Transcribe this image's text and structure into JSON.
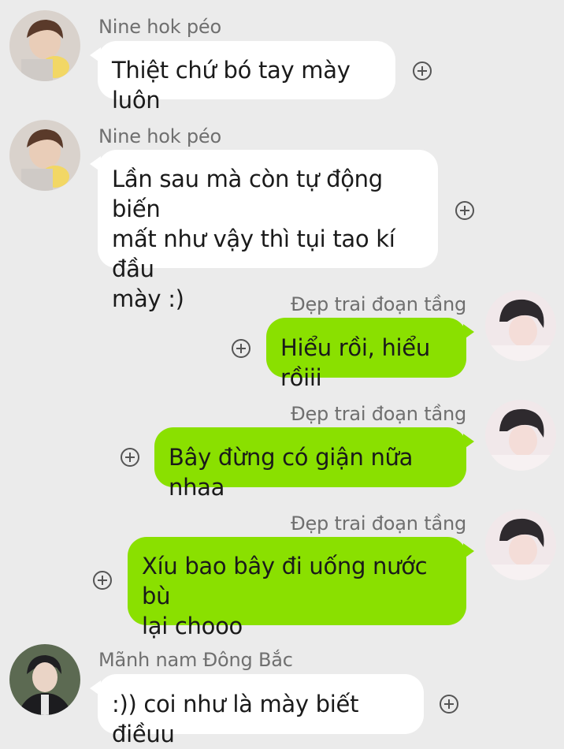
{
  "messages": [
    {
      "sender": "Nine hok péo",
      "direction": "incoming",
      "lines": [
        "Thiệt chứ bó tay mày luôn"
      ]
    },
    {
      "sender": "Nine hok péo",
      "direction": "incoming",
      "lines": [
        "Lần sau mà còn tự động biến",
        "mất như vậy thì tụi tao kí đầu",
        "mày :)"
      ]
    },
    {
      "sender": "Đẹp trai đoạn tầng",
      "direction": "outgoing",
      "lines": [
        "Hiểu rồi, hiểu rồiii"
      ]
    },
    {
      "sender": "Đẹp trai đoạn tầng",
      "direction": "outgoing",
      "lines": [
        "Bây đừng có giận nữa nhaa"
      ]
    },
    {
      "sender": "Đẹp trai đoạn tầng",
      "direction": "outgoing",
      "lines": [
        "Xíu bao bây đi uống nước bù",
        "lại chooo"
      ]
    },
    {
      "sender": "Mãnh nam Đông Bắc",
      "direction": "incoming",
      "lines": [
        ":)) coi như là mày biết điềuu"
      ]
    }
  ],
  "icons": {
    "add_reaction": "plus-circle-icon",
    "avatar": "avatar-photo"
  },
  "colors": {
    "background": "#ebebeb",
    "incoming_bubble": "#ffffff",
    "outgoing_bubble": "#8ae000",
    "sender_text": "#6f6f6f"
  }
}
